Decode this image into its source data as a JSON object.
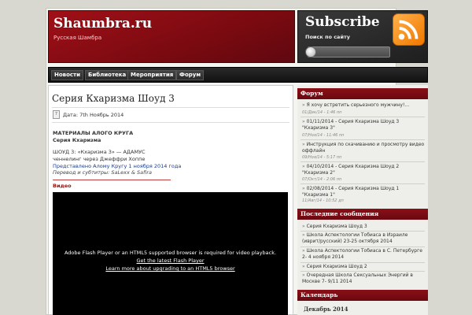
{
  "header": {
    "site_title": "Shaumbra.ru",
    "site_desc": "Русская Шамбра"
  },
  "subscribe": {
    "title": "Subscribe",
    "search_label": "Поиск по сайту",
    "search_value": ""
  },
  "icons": {
    "rss": "rss-feed-icon",
    "search": "magnifier-icon",
    "calendar": "calendar-icon"
  },
  "nav": {
    "items": [
      "Новости",
      "Библиотека",
      "Мероприятия",
      "Форум"
    ]
  },
  "post": {
    "title": "Серия Кхаризма Шоуд 3",
    "date_day": "7",
    "date": "Дата: 7th Ноябрь 2014",
    "lines": [
      "МАТЕРИАЛЫ АЛОГО КРУГА",
      "Серия Кхаризма",
      "ШОУД 3: «Кхаризма 3» — АДАМУС",
      "ченнелинг через Джеффри Хоппе",
      "Представлено Алому Кругу 1 ноября 2014 года",
      "Перевод и субтитры: SaLexx & Safira"
    ],
    "video_label": "Видео",
    "video_msg": "Adobe Flash Player or an HTML5 supported browser is required for video playback.",
    "video_link1": "Get the latest Flash Player",
    "video_link2": "Learn more about upgrading to an HTML5 browser"
  },
  "sidebar": {
    "forum_title": "Форум",
    "forum": [
      {
        "text": "Я хочу встретить серьезного мужчину!...",
        "meta": "01/Дек/14 - 1:46 пп"
      },
      {
        "text": "01/11/2014 - Серия Кхаризма Шоуд 3 \"Кхаризма 3\"",
        "meta": "07/Ноя/14 - 11:46 пп"
      },
      {
        "text": "Инструкция по скачиванию и просмотру видео оффлайн",
        "meta": "09/Ноя/14 - 5:17 пп"
      },
      {
        "text": "04/10/2014 - Серия Кхаризма Шоуд 2 \"Кхаризма 2\"",
        "meta": "07/Окт/14 - 2:06 пп"
      },
      {
        "text": "02/08/2014 - Серия Кхаризма Шоуд 1 \"Кхаризма 1\"",
        "meta": "11/Авг/14 - 10:52 дп"
      }
    ],
    "recent_title": "Последние сообщения",
    "recent": [
      "Серия Кхаризма Шоуд 3",
      "Школа Аспектологии Тобиаса в Израиле (иврит/русский) 23-25 октября 2014",
      "Школа Аспектологии Тобиаса в С. Петербурге 2- 4 ноября 2014",
      "Серия Кхаризма Шоуд 2",
      "Очередная Школа Сексуальных Энергий в Москве 7- 9/11 2014"
    ],
    "calendar_title": "Календарь",
    "calendar_caption": "Декабрь 2014"
  }
}
